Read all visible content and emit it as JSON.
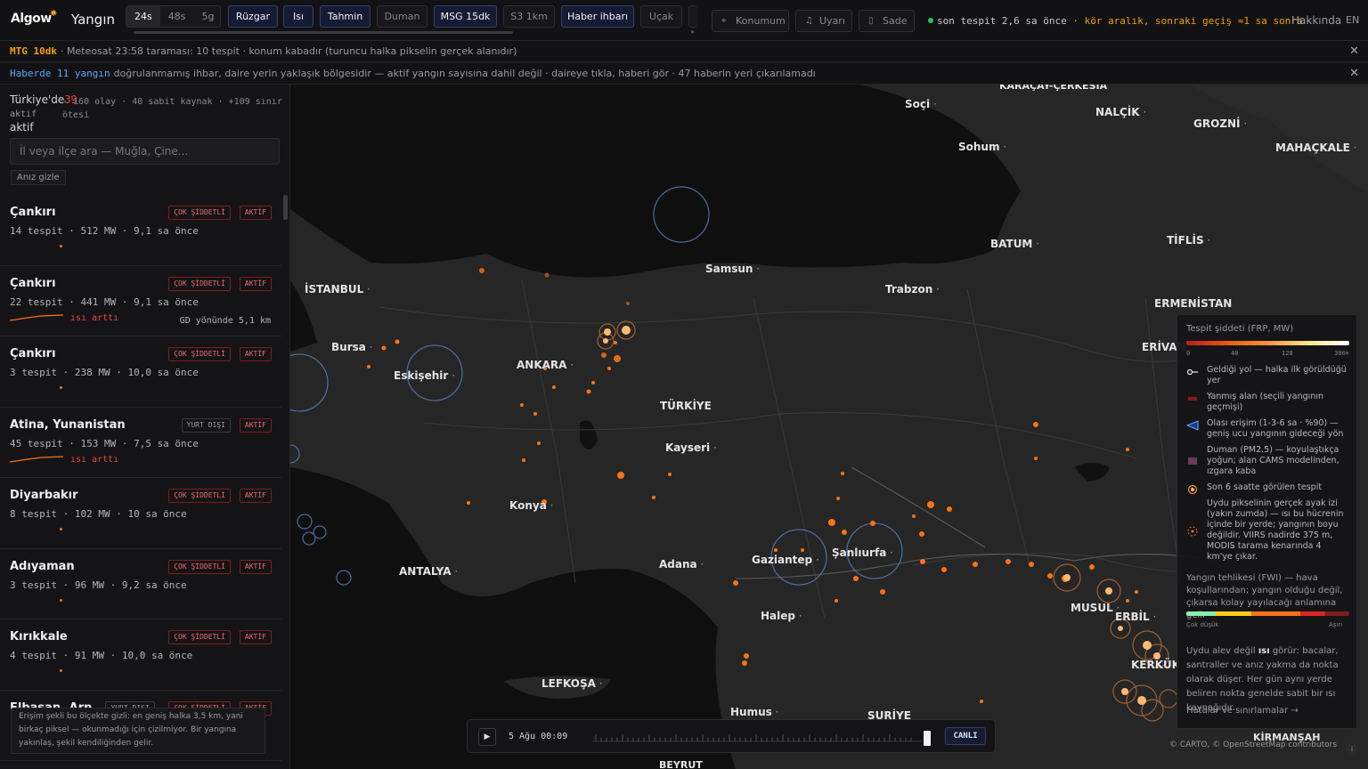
{
  "topbar": {
    "logo": "Algow",
    "title": "Yangın",
    "time_ranges": [
      "24s",
      "48s",
      "5g"
    ],
    "active_time_range": "24s",
    "layers": [
      {
        "label": "Rüzgar",
        "on": true
      },
      {
        "label": "Isı",
        "on": true
      },
      {
        "label": "Tahmin",
        "on": true
      },
      {
        "label": "Duman",
        "on": false
      },
      {
        "label": "MSG 15dk",
        "on": true
      },
      {
        "label": "S3 1km",
        "on": false
      },
      {
        "label": "Haber ihbarı",
        "on": true
      },
      {
        "label": "Uçak",
        "on": false
      }
    ],
    "location_btn": "Konumum",
    "alert_btn": "Uyarı",
    "simple_btn": "Sade",
    "status_live": "son tespit 2,6 sa önce",
    "status_gap": "· kör aralık, sonraki geçiş ≈1 sa sonra",
    "about": "Hakkında",
    "lang": "EN"
  },
  "notices": [
    {
      "tag": "MTG 10dk",
      "tag_color": "#f59e0b",
      "text": "· Meteosat 23:58 taraması: 10 tespit · konum kabadır (turuncu halka pikselin gerçek alanıdır)"
    },
    {
      "tag": "Haberde 11 yangın",
      "tag_color": "#60a5fa",
      "text": "doğrulanmamış ihbar, daire yerin yaklaşık bölgesidir — aktif yangın sayısına dahil değil · daireye tıkla, haberi gör · 47 haberin yeri çıkarılamadı"
    }
  ],
  "sidebar": {
    "country": "Türkiye'de",
    "active_count": "39",
    "active_word": "aktif",
    "stats": "· 160 olay · 40 sabit kaynak · +109 sınır ötesi",
    "search_placeholder": "İl veya ilçe ara — Muğla, Çine...",
    "hide_btn": "Anız gizle",
    "items": [
      {
        "city": "Çankırı",
        "meta": "14 tespit · 512 MW · 9,1 sa önce",
        "badges": [
          "ÇOK ŞİDDETLİ",
          "AKTİF"
        ],
        "trend": "",
        "dir": ""
      },
      {
        "city": "Çankırı",
        "meta": "22 tespit · 441 MW · 9,1 sa önce",
        "badges": [
          "ÇOK ŞİDDETLİ",
          "AKTİF"
        ],
        "trend": "ısı arttı",
        "dir": "GD yönünde 5,1 km"
      },
      {
        "city": "Çankırı",
        "meta": "3 tespit · 238 MW · 10,0 sa önce",
        "badges": [
          "ÇOK ŞİDDETLİ",
          "AKTİF"
        ],
        "trend": "",
        "dir": ""
      },
      {
        "city": "Atina, Yunanistan",
        "meta": "45 tespit · 153 MW · 7,5 sa önce",
        "badges": [
          "YURT DIŞI",
          "AKTİF"
        ],
        "trend": "ısı arttı",
        "dir": ""
      },
      {
        "city": "Diyarbakır",
        "meta": "8 tespit · 102 MW · 10 sa önce",
        "badges": [
          "ÇOK ŞİDDETLİ",
          "AKTİF"
        ],
        "trend": "",
        "dir": ""
      },
      {
        "city": "Adıyaman",
        "meta": "3 tespit · 96 MW · 9,2 sa önce",
        "badges": [
          "ÇOK ŞİDDETLİ",
          "AKTİF"
        ],
        "trend": "",
        "dir": ""
      },
      {
        "city": "Kırıkkale",
        "meta": "4 tespit · 91 MW · 10,0 sa önce",
        "badges": [
          "ÇOK ŞİDDETLİ",
          "AKTİF"
        ],
        "trend": "",
        "dir": ""
      },
      {
        "city": "Elbasan, Arn...",
        "meta": "",
        "badges": [
          "YURT DIŞI",
          "ÇOK ŞİDDETLİ",
          "AKTİF"
        ],
        "trend": "",
        "dir": ""
      }
    ],
    "tip": "Erişim şekli bu ölçekte gizli: en geniş halka 3,5 km, yani birkaç piksel — okunmadığı için çizilmiyor. Bir yangına yakınlaş, şekil kendiliğinden gelir."
  },
  "map": {
    "labels": [
      {
        "text": "KARAÇAY-ÇERKESİA",
        "dot": false
      },
      {
        "text": "Soçi",
        "dot": true
      },
      {
        "text": "NALÇİK",
        "dot": true
      },
      {
        "text": "GROZNİ",
        "dot": true
      },
      {
        "text": "MAHAÇKALE",
        "dot": true
      },
      {
        "text": "Sohum",
        "dot": true
      },
      {
        "text": "BATUM",
        "dot": true
      },
      {
        "text": "TİFLİS",
        "dot": true
      },
      {
        "text": "Samsun",
        "dot": true
      },
      {
        "text": "İSTANBUL",
        "dot": true
      },
      {
        "text": "Trabzon",
        "dot": true
      },
      {
        "text": "ERMENİSTAN",
        "dot": false
      },
      {
        "text": "ERİVAN",
        "dot": false
      },
      {
        "text": "Bursa",
        "dot": true
      },
      {
        "text": "ANKARA",
        "dot": true
      },
      {
        "text": "Eskişehir",
        "dot": true
      },
      {
        "text": "TÜRKİYE",
        "dot": false
      },
      {
        "text": "Kayseri",
        "dot": true
      },
      {
        "text": "Konya",
        "dot": true
      },
      {
        "text": "ANTALYA",
        "dot": true
      },
      {
        "text": "Adana",
        "dot": true
      },
      {
        "text": "Gaziantep",
        "dot": true
      },
      {
        "text": "Şanlıurfa",
        "dot": true
      },
      {
        "text": "MUSUL",
        "dot": true
      },
      {
        "text": "ERBİL",
        "dot": true
      },
      {
        "text": "KERKÜK",
        "dot": true
      },
      {
        "text": "Halep",
        "dot": true
      },
      {
        "text": "LEFKOŞA",
        "dot": true
      },
      {
        "text": "Humus",
        "dot": true
      },
      {
        "text": "SURİYE",
        "dot": false
      },
      {
        "text": "KİRMANŞAH",
        "dot": false
      },
      {
        "text": "BEYRUT",
        "dot": false
      }
    ]
  },
  "legend": {
    "title": "Tespit şiddeti (FRP, MW)",
    "ticks": [
      "0",
      "40",
      "120",
      "300+"
    ],
    "rows": [
      "Geldiği yol — halka ilk görüldüğü yer",
      "Yanmış alan (seçili yangının geçmişi)",
      "Olası erişim (1-3-6 sa · %90) — geniş ucu yangının gideceği yön",
      "Duman (PM2.5) — koyulaştıkça yoğun; alan CAMS modelinden, ızgara kaba",
      "Son 6 saatte görülen tespit",
      "Uydu pikselinin gerçek ayak izi (yakın zumda) — ısı bu hücrenin içinde bir yerde; yangının boyu değildir. VIIRS nadirde 375 m, MODIS tarama kenarında 4 km'ye çıkar."
    ],
    "fwi_text": "Yangın tehlikesi (FWI) — hava koşullarından; yangın olduğu değil, çıkarsa kolay yayılacağı anlamına gelir",
    "fwi_low": "Çok düşük",
    "fwi_high": "Aşırı",
    "note": "Uydu alev değil ısı görür: bacalar, santraller ve anız yakma da nokta olarak düşer. Her gün aynı yerde beliren nokta genelde sabit bir ısı kaynağıdır.",
    "note_bold": "ısı",
    "link": "Hatalar ve sınırlamalar →"
  },
  "timeline": {
    "date": "5 Ağu 00:09",
    "live": "CANLI",
    "position": 0.97
  },
  "attribution": "© CARTO, © OpenStreetMap contributors",
  "colors": {
    "accent_blue": "#34406e",
    "fire": "#f97316",
    "severe": "#ef4444",
    "live_green": "#22c55e",
    "warn": "#f59e0b"
  }
}
